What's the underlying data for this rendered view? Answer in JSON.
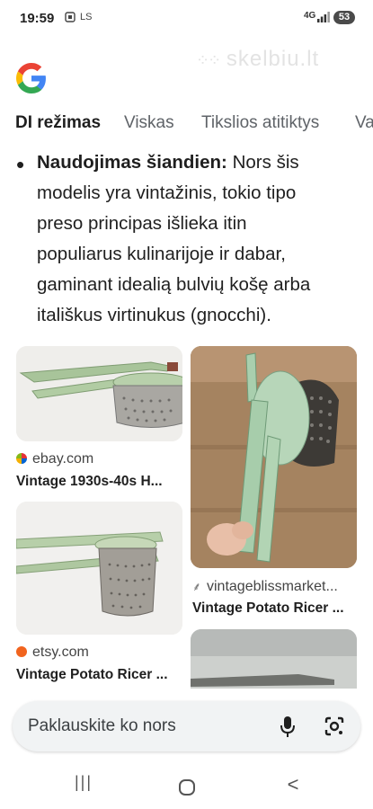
{
  "status": {
    "time": "19:59",
    "carrier_icon_text": "LS",
    "network": "4G",
    "battery": "53"
  },
  "watermark": "skelbiu.lt",
  "tabs": [
    "DI režimas",
    "Viskas",
    "Tikslios atitiktys",
    "Va"
  ],
  "answer": {
    "bold_lead": "Naudojimas šiandien:",
    "text": " Nors šis modelis yra vintažinis, tokio tipo preso principas išlieka itin populiarus kulinarijoje ir dabar, gaminant idealią bulvių košę arba itališkus virtinukus (gnocchi)."
  },
  "images": [
    {
      "source": "ebay.com",
      "caption": "Vintage 1930s-40s H..."
    },
    {
      "source": "vintageblissmarket...",
      "caption": "Vintage Potato Ricer ..."
    },
    {
      "source": "etsy.com",
      "caption": "Vintage Potato Ricer ..."
    }
  ],
  "search": {
    "placeholder": "Paklauskite ko nors"
  },
  "nav": {
    "recents": "|||",
    "home": "○",
    "back": "<"
  },
  "colors": {
    "google_blue": "#4285F4",
    "google_red": "#EA4335",
    "google_yellow": "#FBBC05",
    "google_green": "#34A853",
    "ricer_green": "#a9c9a0"
  }
}
